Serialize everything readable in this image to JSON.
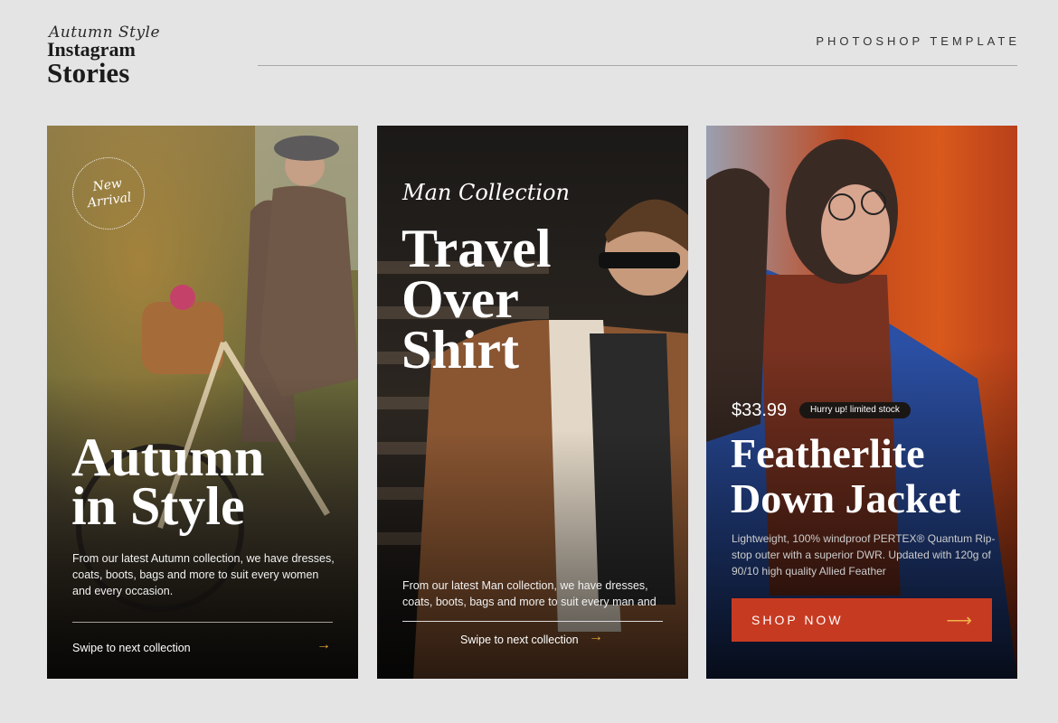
{
  "header": {
    "brand_script": "Autumn Style",
    "brand_line1": "Instagram",
    "brand_line2": "Stories",
    "template_label": "PHOTOSHOP TEMPLATE"
  },
  "cards": [
    {
      "badge_line1": "New",
      "badge_line2": "Arrival",
      "title_line1": "Autumn",
      "title_line2": "in Style",
      "description": "From our latest Autumn collection, we have dresses, coats, boots, bags and more to suit every women and every occasion.",
      "swipe_label": "Swipe to next collection",
      "arrow": "→"
    },
    {
      "script_heading": "Man Collection",
      "title_line1": "Travel",
      "title_line2": "Over",
      "title_line3": "Shirt",
      "description": "From our latest Man collection, we have dresses, coats, boots, bags and more to suit every man and",
      "swipe_label": "Swipe to next collection",
      "arrow": "→"
    },
    {
      "price": "$33.99",
      "pill_label": "Hurry up! limited stock",
      "title_line1": "Featherlite",
      "title_line2": "Down Jacket",
      "description": "Lightweight, 100% windproof PERTEX® Quantum Rip-stop outer with a superior DWR. Updated with 120g of 90/10 high quality Allied Feather",
      "cta_label": "SHOP NOW",
      "arrow": "⟶"
    }
  ],
  "colors": {
    "page_bg": "#e4e4e5",
    "accent_orange": "#c73a22",
    "arrow_gold": "#e8a53b"
  }
}
